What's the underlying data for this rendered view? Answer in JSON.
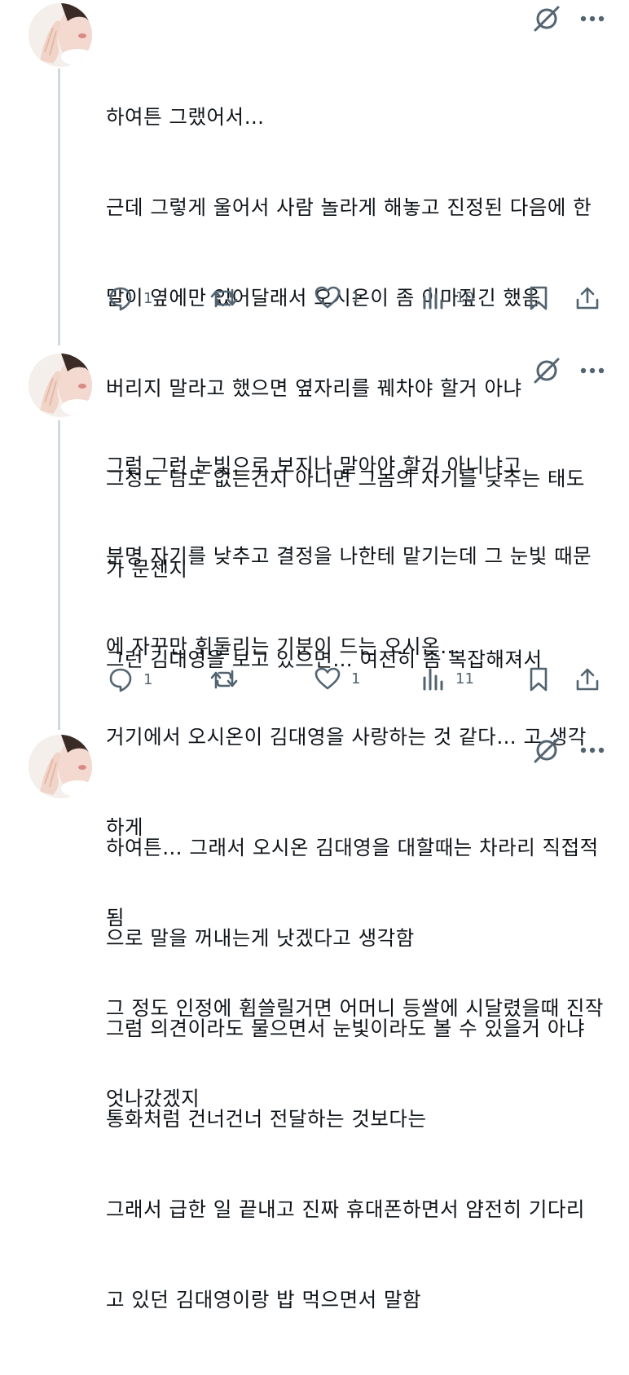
{
  "posts": [
    {
      "lines": [
        "하여튼 그랬어서…",
        "근데 그렇게 울어서 사람 놀라게 해놓고 진정된 다음에 한",
        "말이 옆에만 있어달래서 오시온이 좀 이마짚긴 했음",
        "버리지 말라고 했으면 옆자리를 꿰차야 할거 아냐",
        "그정도 담도 없는건지 아니면 그놈의 자기를 낮추는 태도",
        "가 문젠지",
        "그런 김대영을 보고 있으면… 여전히 좀 복잡해져서"
      ],
      "replies": "1",
      "reposts": "",
      "likes": "1",
      "views": "10"
    },
    {
      "lines": [
        "그럼 그런 눈빛으로 보지나 말아야 할거 아니냐고",
        "분명 자기를 낮추고 결정을 나한테 맡기는데 그 눈빛 때문",
        "에 자꾸만 휘둘리는 기분이 드는 오시온…",
        "거기에서 오시온이 김대영을 사랑하는 것 같다… 고 생각",
        "하게",
        "됨",
        "그 정도 인정에 휩쓸릴거면 어머니 등쌀에 시달렸을때 진작",
        "엇나갔겠지"
      ],
      "replies": "1",
      "reposts": "",
      "likes": "1",
      "views": "11"
    },
    {
      "lines": [
        "하여튼… 그래서 오시온 김대영을 대할때는 차라리 직접적",
        "으로 말을 꺼내는게 낫겠다고 생각함",
        "그럼 의견이라도 물으면서 눈빛이라도 볼 수 있을거 아냐",
        "통화처럼 건너건너 전달하는 것보다는",
        "그래서 급한 일 끝내고 진짜 휴대폰하면서 얌전히 기다리",
        "고 있던 김대영이랑 밥 먹으면서 말함"
      ]
    }
  ],
  "icons": {
    "reply": "reply-icon",
    "repost": "repost-icon",
    "like": "heart-icon",
    "views": "views-icon",
    "bookmark": "bookmark-icon",
    "share": "share-icon",
    "grok": "grok-icon",
    "more": "more-icon"
  },
  "colors": {
    "text": "#0f1419",
    "muted": "#536471",
    "thread_line": "#cfd9de"
  }
}
